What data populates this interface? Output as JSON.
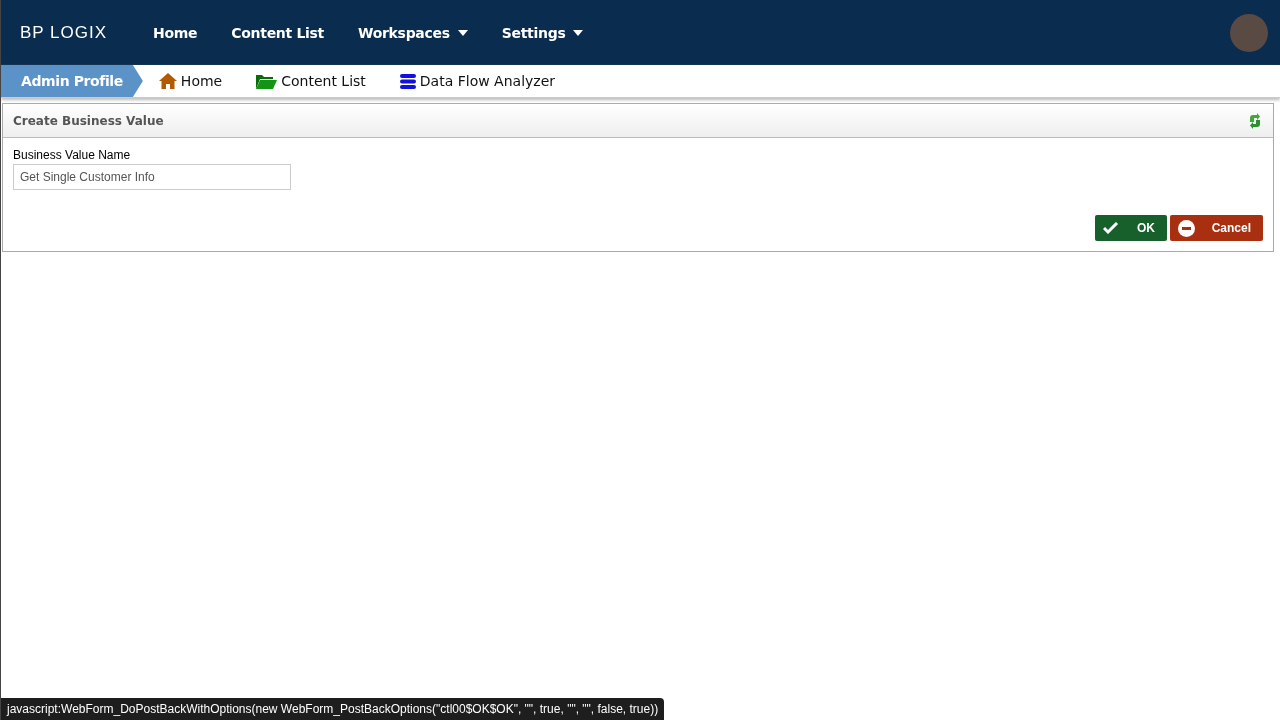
{
  "logo": {
    "text": "BP LOGIX"
  },
  "nav": [
    {
      "label": "Home",
      "dropdown": false
    },
    {
      "label": "Content List",
      "dropdown": false
    },
    {
      "label": "Workspaces",
      "dropdown": true
    },
    {
      "label": "Settings",
      "dropdown": true
    }
  ],
  "breadcrumb": {
    "current": "Admin Profile",
    "links": [
      {
        "label": "Home",
        "kind": "home"
      },
      {
        "label": "Content List",
        "kind": "folder"
      },
      {
        "label": "Data Flow Analyzer",
        "kind": "database"
      }
    ]
  },
  "panel": {
    "title": "Create Business Value",
    "field": {
      "label": "Business Value Name",
      "value": "Get Single Customer Info"
    },
    "buttons": [
      {
        "label": "OK",
        "kind": "ok"
      },
      {
        "label": "Cancel",
        "kind": "cancel"
      }
    ]
  },
  "status_bar": {
    "text": "javascript:WebForm_DoPostBackWithOptions(new WebForm_PostBackOptions(\"ctl00$OK$OK\", \"\", true, \"\", \"\", false, true))"
  }
}
